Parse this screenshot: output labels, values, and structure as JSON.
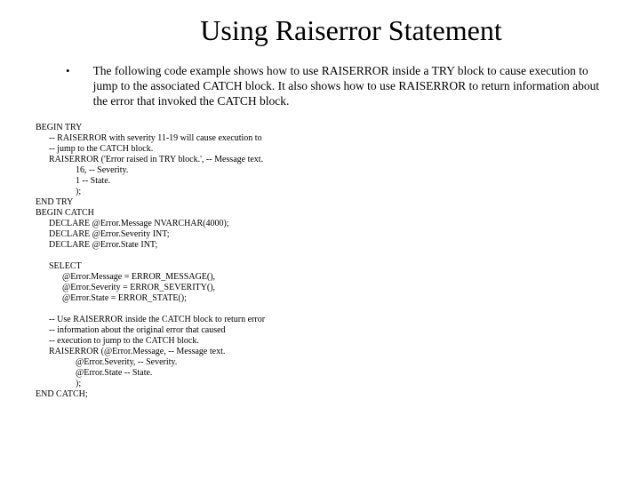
{
  "title": "Using Raiserror Statement",
  "bullet": "The following code example shows how to use RAISERROR inside a TRY block to cause execution to jump to the associated CATCH block. It also shows how to use RAISERROR to return information about the error that invoked the CATCH block.",
  "code": "BEGIN TRY\n      -- RAISERROR with severity 11-19 will cause execution to\n      -- jump to the CATCH block.\n      RAISERROR ('Error raised in TRY block.', -- Message text.\n                  16, -- Severity.\n                  1 -- State.\n                  );\nEND TRY\nBEGIN CATCH\n      DECLARE @Error.Message NVARCHAR(4000);\n      DECLARE @Error.Severity INT;\n      DECLARE @Error.State INT;\n\n      SELECT\n            @Error.Message = ERROR_MESSAGE(),\n            @Error.Severity = ERROR_SEVERITY(),\n            @Error.State = ERROR_STATE();\n\n      -- Use RAISERROR inside the CATCH block to return error\n      -- information about the original error that caused\n      -- execution to jump to the CATCH block.\n      RAISERROR (@Error.Message, -- Message text.\n                  @Error.Severity, -- Severity.\n                  @Error.State -- State.\n                  );\nEND CATCH;"
}
